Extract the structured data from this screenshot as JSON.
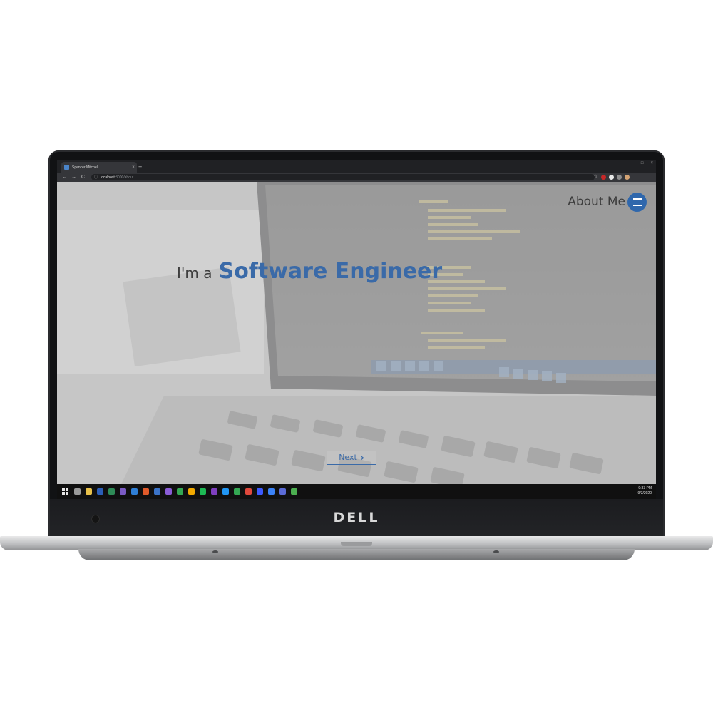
{
  "browser": {
    "tab_title": "Spencer Mitchell",
    "tab_close": "×",
    "new_tab": "+",
    "window_controls": [
      "–",
      "□",
      "×"
    ],
    "nav": {
      "back": "←",
      "forward": "→",
      "reload": "C"
    },
    "address": {
      "info": "ⓘ",
      "host": "localhost",
      "path": ":3000/about"
    },
    "star": "☆"
  },
  "page": {
    "nav_title": "About Me",
    "headline_prefix": "I'm a",
    "headline_role": "Software Engineer",
    "next_label": "Next",
    "next_chevron": "›"
  },
  "taskbar": {
    "time": "9:33 PM",
    "date": "9/3/2020",
    "icon_colors": [
      "#9a9a9a",
      "#e8c14a",
      "#2b5eb7",
      "#2e8b57",
      "#7b5bc4",
      "#2f7fd6",
      "#e05a2a",
      "#3b73c7",
      "#8a5cd6",
      "#34a853",
      "#f2a900",
      "#1db954",
      "#7f3fbf",
      "#2196f3",
      "#34a853",
      "#e0483c",
      "#3d5afe",
      "#3b82f6",
      "#5b6bd6",
      "#4caf50"
    ]
  },
  "device": {
    "brand": "DELL"
  },
  "colors": {
    "accent": "#3a6aa8",
    "menu_button": "#2f67ac"
  }
}
